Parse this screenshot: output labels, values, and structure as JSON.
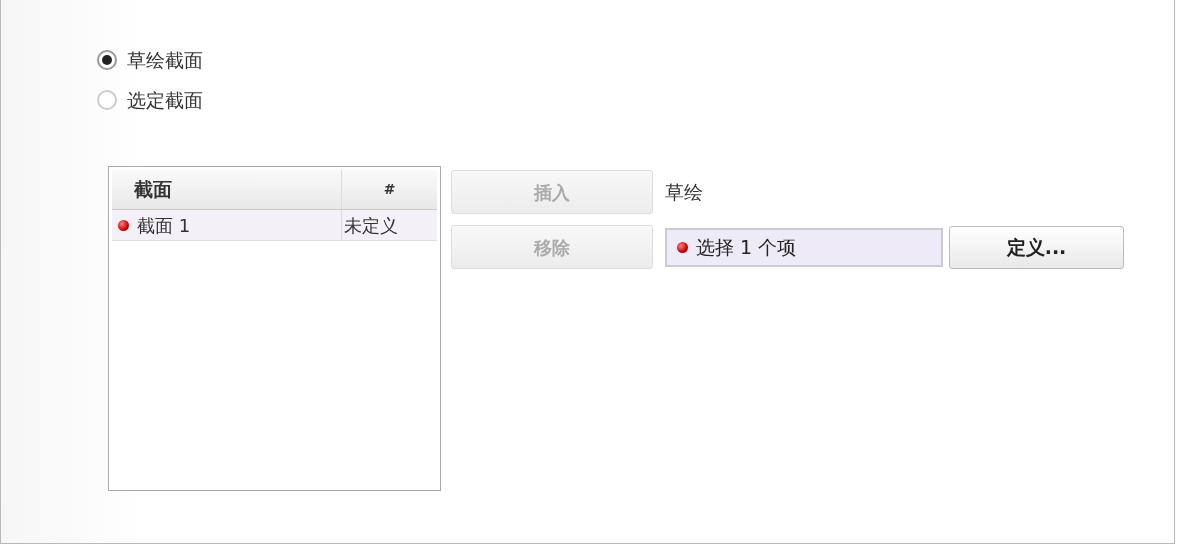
{
  "radios": [
    {
      "label": "草绘截面",
      "selected": true
    },
    {
      "label": "选定截面",
      "selected": false
    }
  ],
  "table": {
    "columns": [
      "截面",
      "#"
    ],
    "rows": [
      {
        "cells": [
          "截面 1",
          "未定义"
        ],
        "invalid": true,
        "selected": true
      }
    ]
  },
  "buttons": [
    {
      "label": "插入",
      "disabled": true
    },
    {
      "label": "移除",
      "disabled": true
    }
  ],
  "sketch_label": "草绘",
  "collector": {
    "value": "选择 1 个项",
    "invalid": true
  },
  "define_button": {
    "label": "定义..."
  }
}
